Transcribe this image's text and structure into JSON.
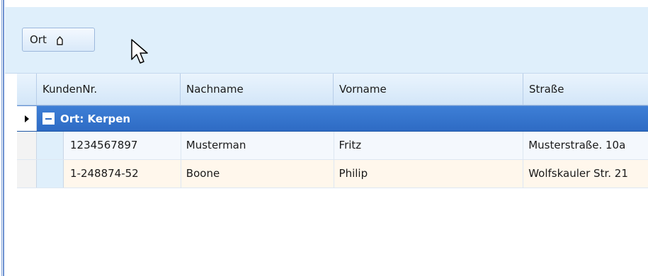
{
  "group_panel": {
    "chip_label": "Ort",
    "sort_icon": "sort-ascending-icon"
  },
  "grid": {
    "columns": [
      "KundenNr.",
      "Nachname",
      "Vorname",
      "Straße"
    ],
    "group": {
      "label": "Ort: Kerpen",
      "expanded": true
    },
    "rows": [
      [
        "1234567897",
        "Musterman",
        "Fritz",
        "Musterstraße. 10a"
      ],
      [
        "1-248874-52",
        "Boone",
        "Philip",
        "Wolfskauler Str. 21"
      ]
    ]
  },
  "colors": {
    "group_row": "#2e6bc4",
    "panel_background": "#dfeffb",
    "alt_row": "#fff7ec"
  }
}
